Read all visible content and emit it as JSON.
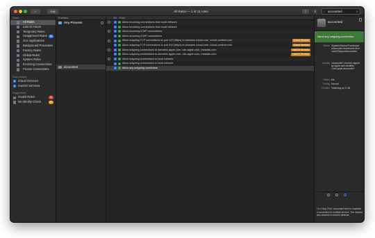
{
  "toolbar": {
    "add_label": "+",
    "edit_label": "Edit",
    "title": "All Rules  —  1 of 11 rules",
    "share_icon": "share-icon",
    "search_value": "accounted",
    "clear_icon": "✕"
  },
  "sidebar": {
    "rules_heading": "Rules",
    "items": [
      {
        "label": "All Rules",
        "icon": "all-rules-icon",
        "selected": true,
        "badge": ""
      },
      {
        "label": "Last 24 Hours",
        "icon": "clock-icon",
        "badge": ""
      },
      {
        "label": "Temporary Rules",
        "icon": "hourglass-icon",
        "badge": ""
      },
      {
        "label": "Unapproved Rules",
        "icon": "unapproved-icon",
        "badge": "12"
      },
      {
        "label": "GUI Applications",
        "icon": "app-icon",
        "badge": ""
      },
      {
        "label": "Background Processes",
        "icon": "gear-icon",
        "badge": ""
      },
      {
        "label": "Factory Rules",
        "icon": "factory-icon",
        "badge": ""
      },
      {
        "label": "Global Rules",
        "icon": "globe-icon",
        "badge": ""
      },
      {
        "label": "System Rules",
        "icon": "system-icon",
        "badge": ""
      },
      {
        "label": "Incoming Connections",
        "icon": "incoming-icon",
        "badge": ""
      },
      {
        "label": "Private Connections",
        "icon": "private-icon",
        "badge": ""
      }
    ],
    "rule_groups_heading": "Rule Groups",
    "groups": [
      {
        "label": "iCloud Services"
      },
      {
        "label": "macOS Services"
      }
    ],
    "suggestions_heading": "Suggestions",
    "suggestions": [
      {
        "label": "Invalid Rules",
        "badge": "5",
        "badge_color": "#e0443e"
      },
      {
        "label": "No Identity Check",
        "badge": "6",
        "badge_color": "#f09a2a"
      }
    ]
  },
  "processes": {
    "header": "Process",
    "items": [
      {
        "label": "Any Process",
        "bold": true
      },
      {
        "label": "accounted",
        "selected": true
      }
    ]
  },
  "rules": {
    "headers": {
      "on": "On",
      "rule": "Rule"
    },
    "rows": [
      {
        "text": "Allow incoming connections from local network",
        "tag": ""
      },
      {
        "text": "Allow incoming connections from local network",
        "tag": ""
      },
      {
        "text": "Allow incoming ICMP connections",
        "tag": ""
      },
      {
        "text": "Allow incoming ICMP connections",
        "tag": ""
      },
      {
        "text": "Allow outgoing TCP connections to port 443 (https) in domains icloud.com, icloud-content.com",
        "tag": "iCloud Services"
      },
      {
        "text": "Allow outgoing TCP connections to port 443 (https) in domains icloud.com, icloud-content.com",
        "tag": "iCloud Services"
      },
      {
        "text": "Allow outgoing connections to domains apple.com, cdn-apple.com, mzstatic.com",
        "tag": "macOS Services"
      },
      {
        "text": "Allow outgoing connections to domains apple.com, cdn-apple.com, mzstatic.com",
        "tag": "macOS Services"
      },
      {
        "text": "Allow outgoing connections to local network",
        "tag": ""
      },
      {
        "text": "Allow outgoing connections to local network",
        "tag": ""
      },
      {
        "text": "Allow any outgoing connection",
        "tag": "",
        "selected": true
      }
    ]
  },
  "inspector": {
    "title": "accounted",
    "banner": "Allow any outgoing connection",
    "fields": [
      {
        "key": "Where",
        "value": "/System/Library/Frameworks/Accounts.framework/Versions/A/Support/accounted"
      },
      {
        "key": "Identity",
        "value": "\"accounted\" must be signed by Apple with identifier \"com.apple.accounted\""
      },
      {
        "key": "Owner",
        "value": "Me"
      },
      {
        "key": "Priority",
        "value": "Normal"
      },
      {
        "key": "Created",
        "value": "Yesterday at 17:46"
      }
    ],
    "note": "On 4 Sep 2019, accounted tried to establish a connection to multiple servers. The request was allowed in network defaults."
  }
}
